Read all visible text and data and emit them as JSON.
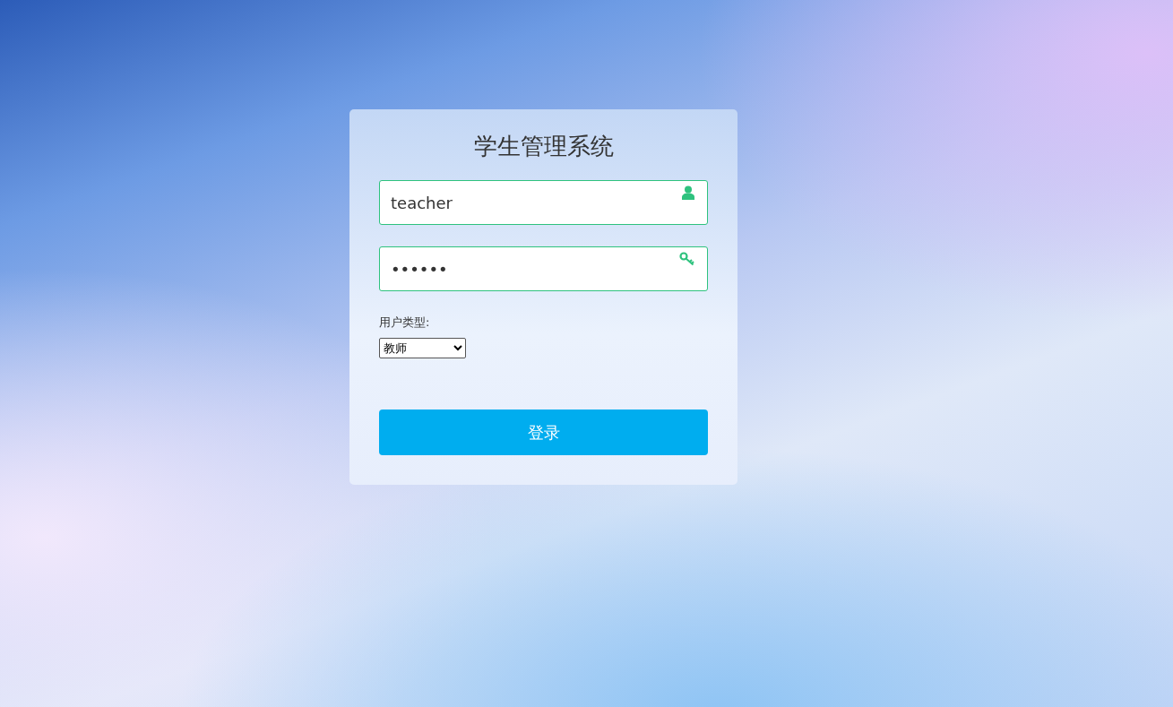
{
  "title": "学生管理系统",
  "username": {
    "value": "teacher"
  },
  "password": {
    "value": "••••••"
  },
  "user_type": {
    "label": "用户类型:",
    "value": "教师"
  },
  "login_button": {
    "label": "登录"
  }
}
